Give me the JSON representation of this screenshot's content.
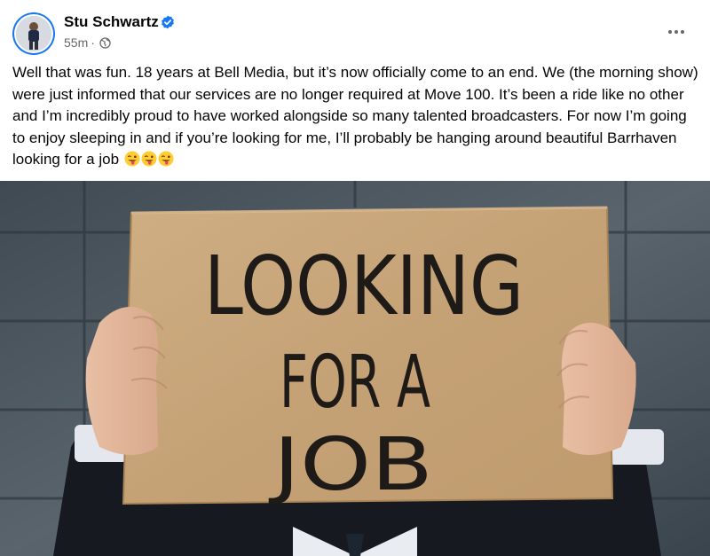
{
  "post": {
    "author_name": "Stu Schwartz",
    "time": "55m",
    "separator": "·",
    "verified_icon": "verified-badge-icon",
    "privacy_icon": "globe-icon",
    "more_icon": "more-options-icon",
    "text": "Well that was fun. 18 years at Bell Media, but it’s now officially come to an  end. We (the morning show) were just informed that our services are no longer required at Move 100. It’s been a ride like no other and I’m incredibly proud to have worked alongside so many talented broadcasters. For now I’m going to enjoy sleeping in and if you’re looking for me, I’ll probably be hanging around beautiful Barrhaven looking for a job",
    "emojis": [
      "😜",
      "😜",
      "😜"
    ]
  },
  "photo": {
    "sign_lines": [
      "LOOKING",
      "FOR A",
      "JOB"
    ]
  },
  "colors": {
    "accent": "#1877f2",
    "text": "#050505",
    "secondary_text": "#65676b",
    "cardboard": "#c9a77c",
    "wall": "#4f5a63"
  }
}
